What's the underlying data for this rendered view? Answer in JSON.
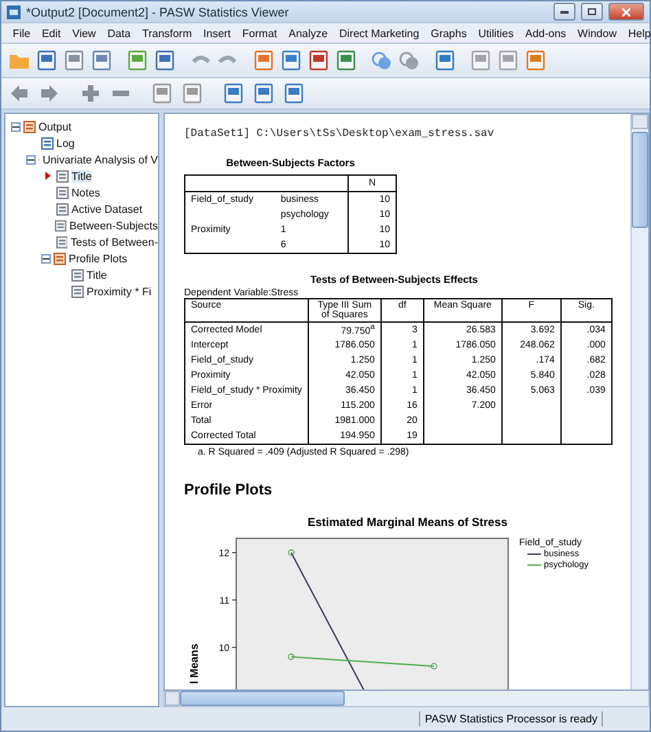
{
  "window": {
    "title": "*Output2 [Document2] - PASW Statistics Viewer"
  },
  "menu": [
    "File",
    "Edit",
    "View",
    "Data",
    "Transform",
    "Insert",
    "Format",
    "Analyze",
    "Direct Marketing",
    "Graphs",
    "Utilities",
    "Add-ons",
    "Window",
    "Help"
  ],
  "outline": [
    {
      "label": "Output",
      "expanded": true,
      "selected": false,
      "children": [
        {
          "label": "Log",
          "selected": false
        },
        {
          "label": "Univariate Analysis of V",
          "expanded": true,
          "selected": false,
          "children": [
            {
              "label": "Title",
              "selected": true
            },
            {
              "label": "Notes",
              "selected": false
            },
            {
              "label": "Active Dataset",
              "selected": false
            },
            {
              "label": "Between-Subjects",
              "selected": false
            },
            {
              "label": "Tests of Between-",
              "selected": false
            },
            {
              "label": "Profile Plots",
              "expanded": true,
              "selected": false,
              "children": [
                {
                  "label": "Title",
                  "selected": false
                },
                {
                  "label": "Proximity * Fi",
                  "selected": false
                }
              ]
            }
          ]
        }
      ]
    }
  ],
  "document": {
    "dataset_line": "[DataSet1] C:\\Users\\tSs\\Desktop\\exam_stress.sav",
    "factors_table": {
      "title": "Between-Subjects Factors",
      "header": "N",
      "rows": [
        [
          "Field_of_study",
          "business",
          "10"
        ],
        [
          "",
          "psychology",
          "10"
        ],
        [
          "Proximity",
          "1",
          "10"
        ],
        [
          "",
          "6",
          "10"
        ]
      ]
    },
    "effects_table": {
      "title": "Tests of Between-Subjects Effects",
      "subtitle": "Dependent Variable:Stress",
      "columns": [
        "Source",
        "Type III Sum of Squares",
        "df",
        "Mean Square",
        "F",
        "Sig."
      ],
      "rows": [
        [
          "Corrected Model",
          "79.750$^{a}$",
          "3",
          "26.583",
          "3.692",
          ".034"
        ],
        [
          "Intercept",
          "1786.050",
          "1",
          "1786.050",
          "248.062",
          ".000"
        ],
        [
          "Field_of_study",
          "1.250",
          "1",
          "1.250",
          ".174",
          ".682"
        ],
        [
          "Proximity",
          "42.050",
          "1",
          "42.050",
          "5.840",
          ".028"
        ],
        [
          "Field_of_study * Proximity",
          "36.450",
          "1",
          "36.450",
          "5.063",
          ".039"
        ],
        [
          "Error",
          "115.200",
          "16",
          "7.200",
          "",
          ""
        ],
        [
          "Total",
          "1981.000",
          "20",
          "",
          "",
          ""
        ],
        [
          "Corrected Total",
          "194.950",
          "19",
          "",
          "",
          ""
        ]
      ],
      "footnote": "a. R Squared = .409 (Adjusted R Squared = .298)"
    },
    "section_heading": "Profile Plots",
    "chart": {
      "title": "Estimated Marginal Means of Stress",
      "axis_label": "l Means",
      "y_tick_labels": [
        "12",
        "11",
        "10"
      ],
      "legend_title": "Field_of_study",
      "legend": [
        {
          "name": "business",
          "color": "#3a3a5a"
        },
        {
          "name": "psychology",
          "color": "#4caf50"
        }
      ]
    }
  },
  "status_bar": {
    "message": "PASW Statistics Processor is ready"
  }
}
